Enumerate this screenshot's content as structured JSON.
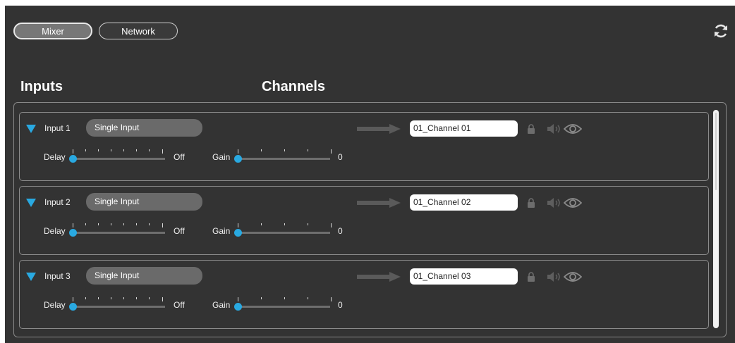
{
  "top_tabs": {
    "mixer": "Mixer",
    "network": "Network"
  },
  "sections": {
    "inputs": "Inputs",
    "channels": "Channels"
  },
  "icons": {
    "refresh": "refresh-icon",
    "expand": "triangle-down-icon",
    "arrow": "arrow-right-icon",
    "lock": "lock-icon",
    "speaker": "speaker-icon",
    "eye": "eye-icon"
  },
  "colors": {
    "accent": "#29a9e1",
    "background": "#333333",
    "pill": "#6a6a6a"
  },
  "rows": [
    {
      "input": "Input 1",
      "mode": "Single Input",
      "channel": "01_Channel 01",
      "delay_label": "Delay",
      "delay_value": "Off",
      "delay_level": 0,
      "gain_label": "Gain",
      "gain_value": "0",
      "gain_level": 0
    },
    {
      "input": "Input 2",
      "mode": "Single Input",
      "channel": "01_Channel 02",
      "delay_label": "Delay",
      "delay_value": "Off",
      "delay_level": 0,
      "gain_label": "Gain",
      "gain_value": "0",
      "gain_level": 0
    },
    {
      "input": "Input 3",
      "mode": "Single Input",
      "channel": "01_Channel 03",
      "delay_label": "Delay",
      "delay_value": "Off",
      "delay_level": 0,
      "gain_label": "Gain",
      "gain_value": "0",
      "gain_level": 0
    }
  ]
}
